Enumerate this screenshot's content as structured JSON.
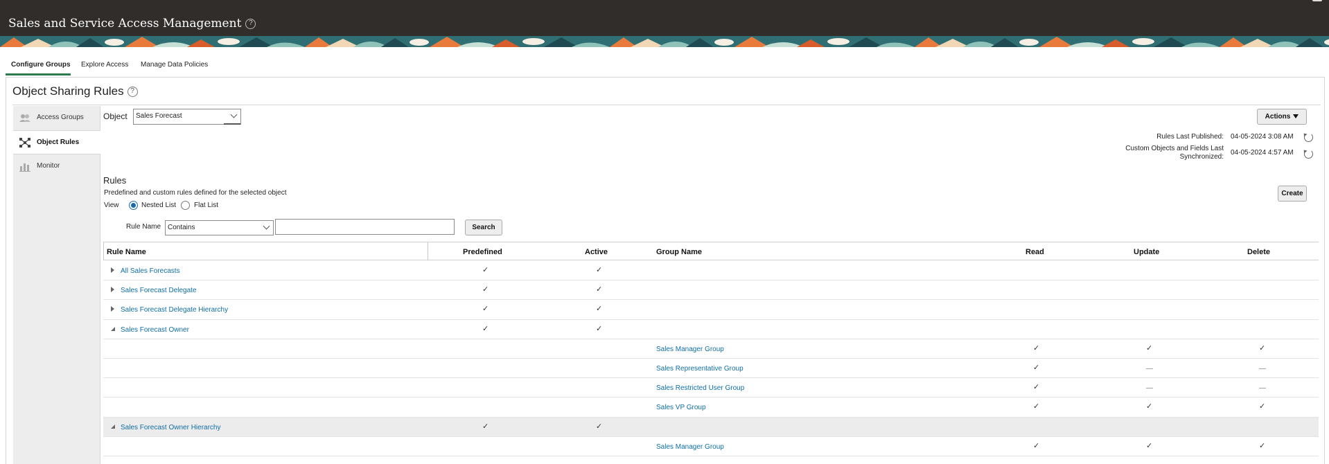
{
  "header": {
    "title": "Sales and Service Access Management",
    "help_icon": "?"
  },
  "tabs": [
    {
      "label": "Configure Groups",
      "active": true
    },
    {
      "label": "Explore Access",
      "active": false
    },
    {
      "label": "Manage Data Policies",
      "active": false
    }
  ],
  "page": {
    "title": "Object Sharing Rules",
    "help_icon": "?"
  },
  "sidenav": [
    {
      "label": "Access Groups",
      "icon": "access-groups-icon",
      "active": false
    },
    {
      "label": "Object Rules",
      "icon": "object-rules-icon",
      "active": true
    },
    {
      "label": "Monitor",
      "icon": "monitor-icon",
      "active": false
    }
  ],
  "object": {
    "label": "Object",
    "value": "Sales Forecast"
  },
  "actions_label": "Actions",
  "published": {
    "label": "Rules Last Published:",
    "value": "04-05-2024 3:08 AM"
  },
  "synchronized": {
    "label_line1": "Custom Objects and Fields Last",
    "label_line2": "Synchronized:",
    "value": "04-05-2024 4:57 AM"
  },
  "rules": {
    "heading": "Rules",
    "description": "Predefined and custom rules defined for the selected object",
    "view_label": "View",
    "view_options": [
      "Nested List",
      "Flat List"
    ],
    "selected_view": "Nested List",
    "create_label": "Create",
    "search": {
      "field_label": "Rule Name",
      "operator": "Contains",
      "value": "",
      "button": "Search"
    }
  },
  "table": {
    "columns": [
      "Rule Name",
      "Predefined",
      "Active",
      "Group Name",
      "Read",
      "Update",
      "Delete"
    ],
    "check_glyph": "✓",
    "dash_glyph": "—",
    "rows": [
      {
        "rule": "All Sales Forecasts",
        "expanded": false,
        "predefined": "✓",
        "active": "✓"
      },
      {
        "rule": "Sales Forecast Delegate",
        "expanded": false,
        "predefined": "✓",
        "active": "✓"
      },
      {
        "rule": "Sales Forecast Delegate Hierarchy",
        "expanded": false,
        "predefined": "✓",
        "active": "✓"
      },
      {
        "rule": "Sales Forecast Owner",
        "expanded": true,
        "predefined": "✓",
        "active": "✓"
      },
      {
        "group": "Sales Manager Group",
        "read": "✓",
        "update": "✓",
        "delete": "✓"
      },
      {
        "group": "Sales Representative Group",
        "read": "✓",
        "update": "—",
        "delete": "—"
      },
      {
        "group": "Sales Restricted User Group",
        "read": "✓",
        "update": "—",
        "delete": "—"
      },
      {
        "group": "Sales VP Group",
        "read": "✓",
        "update": "✓",
        "delete": "✓"
      },
      {
        "rule": "Sales Forecast Owner Hierarchy",
        "expanded": true,
        "predefined": "✓",
        "active": "✓",
        "highlighted": true
      },
      {
        "group": "Sales Manager Group",
        "read": "✓",
        "update": "✓",
        "delete": "✓"
      }
    ]
  },
  "colors": {
    "header_bg": "#312d2a",
    "link": "#0f6ea5",
    "tab_underline": "#2d7a4f",
    "nav_bg": "#ededed"
  }
}
